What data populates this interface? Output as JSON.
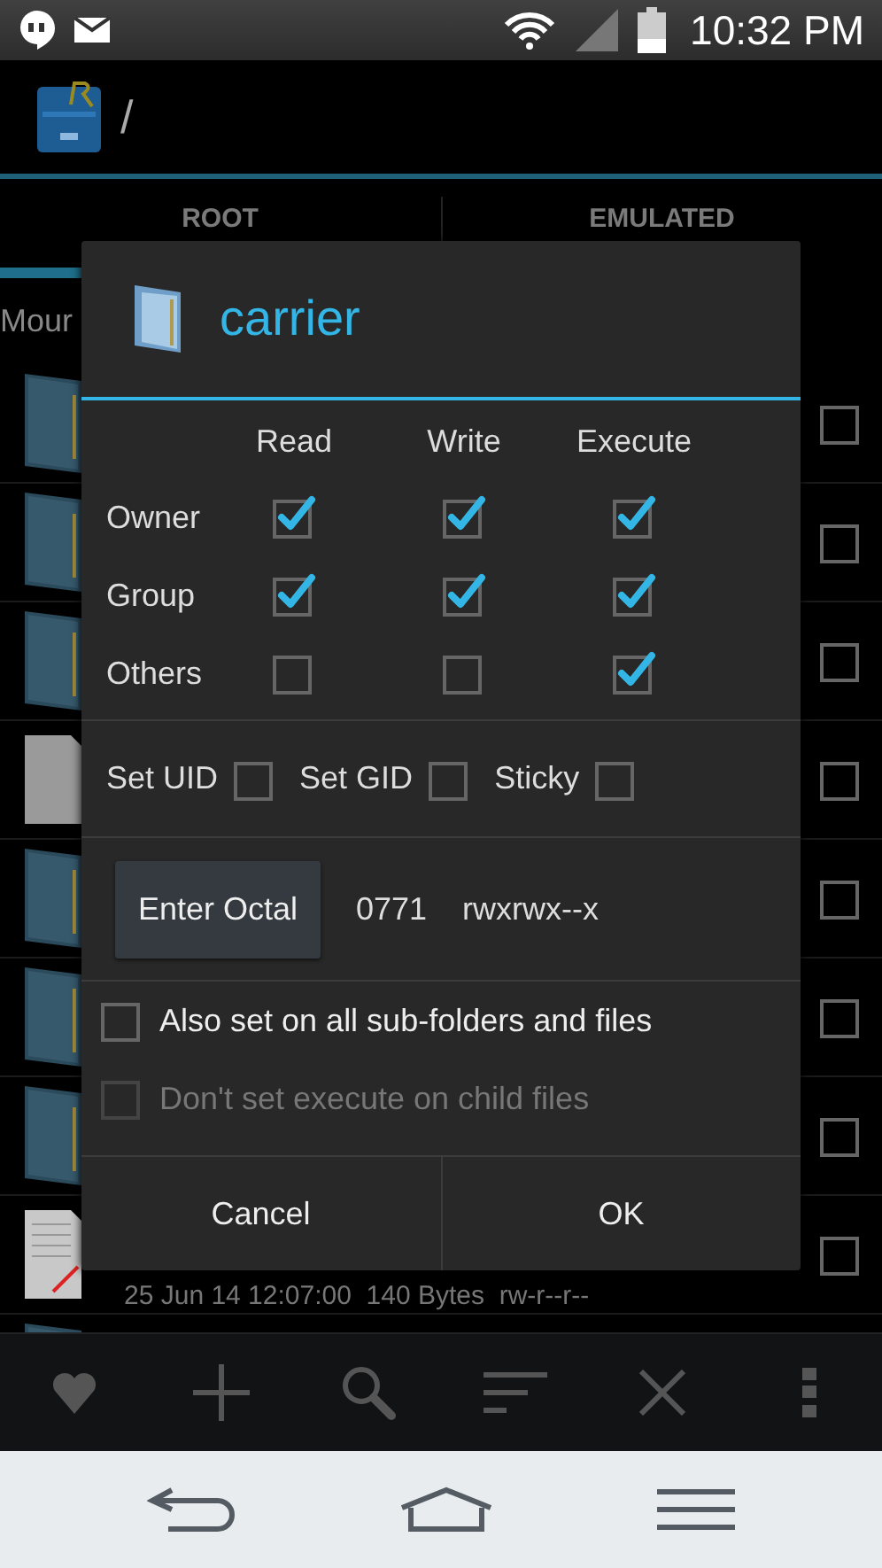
{
  "status_bar": {
    "time": "10:32 PM"
  },
  "app_bar": {
    "path": "/"
  },
  "tabs": [
    {
      "label": "ROOT",
      "selected": true
    },
    {
      "label": "EMULATED",
      "selected": false
    }
  ],
  "file_list": {
    "header": "Mour",
    "rows": [
      {
        "kind": "folder",
        "checked": false
      },
      {
        "kind": "folder",
        "checked": false
      },
      {
        "kind": "folder",
        "checked": false
      },
      {
        "kind": "file",
        "checked": false
      },
      {
        "kind": "folder",
        "checked": false
      },
      {
        "kind": "folder",
        "checked": false
      },
      {
        "kind": "folder",
        "checked": false
      },
      {
        "kind": "text-file",
        "checked": false,
        "details": "25 Jun 14 12:07:00  140 Bytes  rw-r--r--"
      },
      {
        "kind": "folder"
      }
    ]
  },
  "dialog": {
    "title": "carrier",
    "columns": [
      "Read",
      "Write",
      "Execute"
    ],
    "permissions": [
      {
        "label": "Owner",
        "cells": [
          {
            "checked": true
          },
          {
            "checked": true
          },
          {
            "checked": true
          }
        ]
      },
      {
        "label": "Group",
        "cells": [
          {
            "checked": true
          },
          {
            "checked": true
          },
          {
            "checked": true
          }
        ]
      },
      {
        "label": "Others",
        "cells": [
          {
            "checked": false
          },
          {
            "checked": false
          },
          {
            "checked": true
          }
        ]
      }
    ],
    "special": [
      {
        "label": "Set UID",
        "checked": false
      },
      {
        "label": "Set GID",
        "checked": false
      },
      {
        "label": "Sticky",
        "checked": false
      }
    ],
    "octal_button": "Enter Octal",
    "octal": "0771",
    "symbolic": "rwxrwx--x",
    "options": [
      {
        "label": "Also set on all sub-folders and files",
        "checked": false,
        "disabled": false
      },
      {
        "label": "Don't set execute on child files",
        "checked": false,
        "disabled": true
      }
    ],
    "buttons": [
      "Cancel",
      "OK"
    ]
  }
}
